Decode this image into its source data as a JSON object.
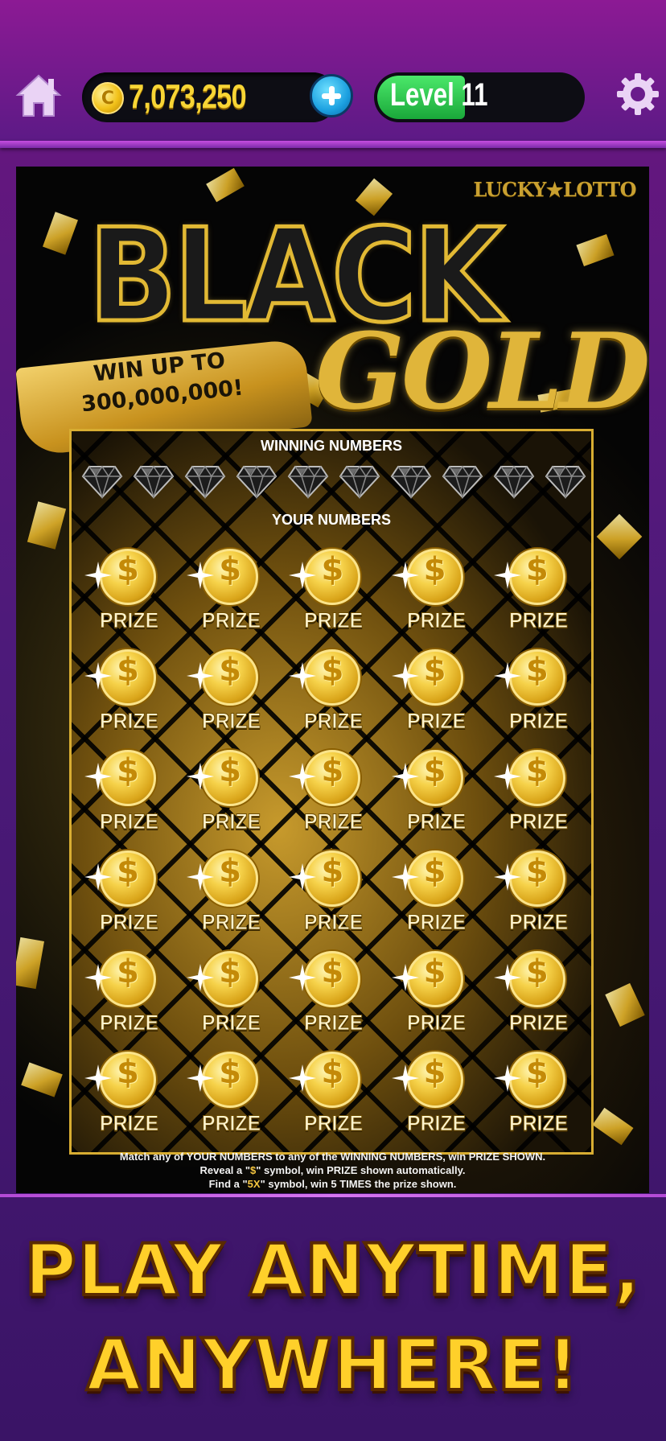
{
  "header": {
    "coins": "7,073,250",
    "level_label": "Level 11",
    "level_progress": 0.43
  },
  "ticket": {
    "brand": "LUCKY★LOTTO",
    "title_line1": "BLACK",
    "title_line2": "GOLD",
    "banner_line1": "WIN UP TO",
    "banner_line2": "300,000,000!",
    "winning_numbers_label": "WINNING NUMBERS",
    "your_numbers_label": "YOUR NUMBERS",
    "prize_label": "PRIZE",
    "rules_line1_a": "Match any of ",
    "rules_line1_b": "YOUR NUMBERS",
    "rules_line1_c": " to any of the ",
    "rules_line1_d": "WINNING NUMBERS",
    "rules_line1_e": ", win ",
    "rules_line1_f": "PRIZE SHOWN",
    "rules_line1_g": ".",
    "rules_line2_a": "Reveal a \"",
    "rules_line2_b": "\" symbol, win ",
    "rules_line2_c": "PRIZE",
    "rules_line2_d": " shown automatically.",
    "rules_line3_a": "Find a \"",
    "rules_line3_b": "5X",
    "rules_line3_c": "\" symbol, win 5 TIMES the prize shown."
  },
  "promo": {
    "line1": "PLAY ANYTIME,",
    "line2": "ANYWHERE!"
  },
  "colors": {
    "accent_gold": "#f5c640",
    "level_green": "#1aa83a",
    "coin_gold": "#f8d535"
  },
  "icons": {
    "home": "home-icon",
    "coin": "coin-icon",
    "add": "plus-icon",
    "settings": "gear-icon",
    "winning_symbol": "diamond-icon",
    "scratch_symbol": "dollar-coin-icon"
  }
}
